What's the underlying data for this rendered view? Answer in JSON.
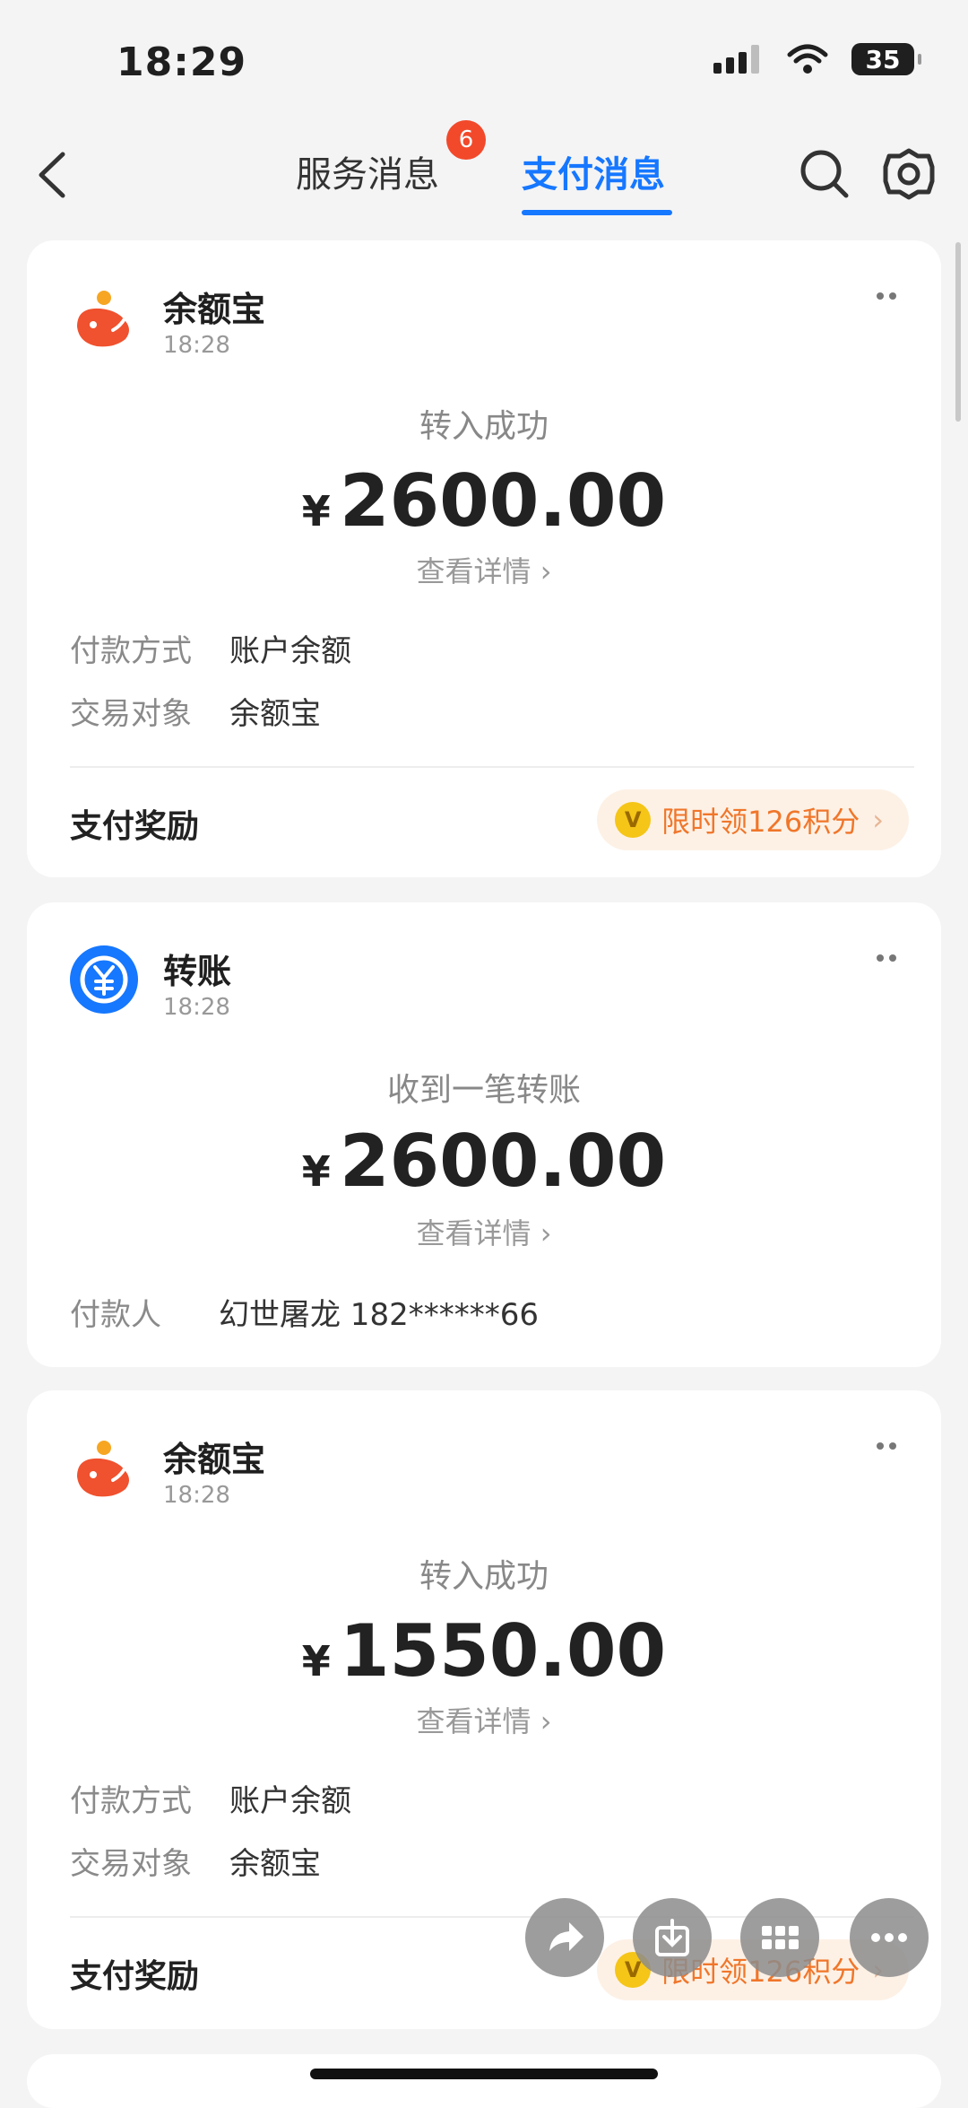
{
  "status": {
    "time": "18:29",
    "battery": "35"
  },
  "nav": {
    "tab_service": "服务消息",
    "tab_pay": "支付消息",
    "badge": "6"
  },
  "cards": [
    {
      "app": "余额宝",
      "time": "18:28",
      "title": "转入成功",
      "currency": "¥",
      "amount": "2600.00",
      "detail": "查看详情",
      "rows": [
        {
          "label": "付款方式",
          "value": "账户余额"
        },
        {
          "label": "交易对象",
          "value": "余额宝"
        }
      ],
      "reward_label": "支付奖励",
      "reward_text": "限时领126积分"
    },
    {
      "app": "转账",
      "time": "18:28",
      "title": "收到一笔转账",
      "currency": "¥",
      "amount": "2600.00",
      "detail": "查看详情",
      "rows": [
        {
          "label": "付款人",
          "value": "幻世屠龙 182******66"
        }
      ]
    },
    {
      "app": "余额宝",
      "time": "18:28",
      "title": "转入成功",
      "currency": "¥",
      "amount": "1550.00",
      "detail": "查看详情",
      "rows": [
        {
          "label": "付款方式",
          "value": "账户余额"
        },
        {
          "label": "交易对象",
          "value": "余额宝"
        }
      ],
      "reward_label": "支付奖励",
      "reward_text": "限时领126积分"
    }
  ],
  "colors": {
    "accent": "#1677ff",
    "badge": "#f2492b",
    "reward": "#f0762a"
  },
  "icons": [
    "back-icon",
    "search-icon",
    "gear-icon",
    "yuebao-icon",
    "transfer-icon",
    "more-icon",
    "share-icon",
    "download-icon",
    "grid-icon",
    "ellipsis-icon"
  ]
}
